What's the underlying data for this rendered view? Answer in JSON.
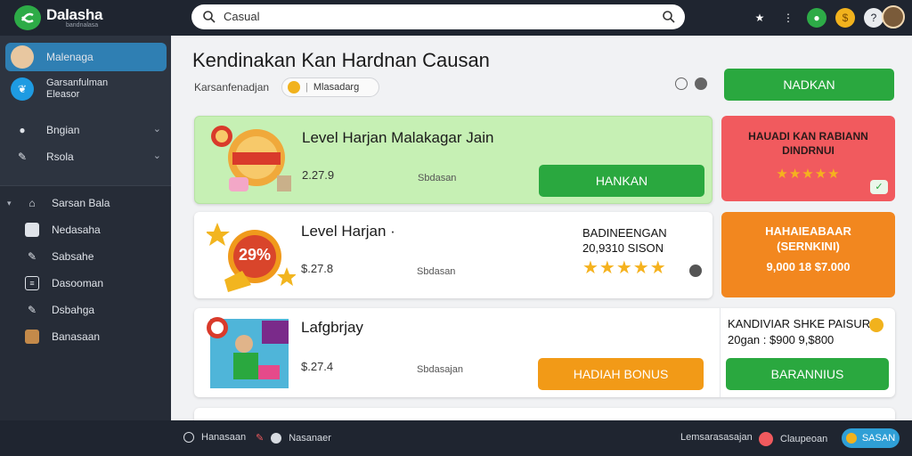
{
  "app": {
    "brand": "Dalasha",
    "brand_sub": "bandnalasa"
  },
  "search": {
    "value": "Casual"
  },
  "sidebar": {
    "items": [
      {
        "label": "Malenaga"
      },
      {
        "label": "Garsanfulman Eleasor"
      },
      {
        "label": "Bngian"
      },
      {
        "label": "Rsola"
      },
      {
        "label": "Sarsan Bala"
      },
      {
        "label": "Nedasaha"
      },
      {
        "label": "Sabsahe"
      },
      {
        "label": "Dasooman"
      },
      {
        "label": "Dsbahga"
      },
      {
        "label": "Banasaan"
      }
    ]
  },
  "main": {
    "title": "Kendinakan Kan Hardnan Causan",
    "breadcrumb": "Karsanfenadjan",
    "chip_label": "Mlasadarg",
    "top_button": "NADKAN"
  },
  "cards": [
    {
      "title": "Level Harjan Malakagar Jain",
      "price": "2.27.9",
      "sub": "Sbdasan",
      "button": "HANKAN"
    },
    {
      "title": "Level Harjan ·",
      "price": "$.27.8",
      "sub": "Sbdasan",
      "promo_title": "BADINEENGAN",
      "promo_line": "20,9310 SISON",
      "art_badge": "29%"
    },
    {
      "title": "Lafgbrjay",
      "price": "$.27.4",
      "sub": "Sbdasajan",
      "button": "HADIAH BONUS"
    }
  ],
  "side_cards": [
    {
      "title": "HAUADI KAN RABIANN",
      "subtitle": "DINDRNUI"
    },
    {
      "title": "HAHAIEABAAR",
      "subtitle": "(SERNKINI)",
      "line": "9,000 18 $7.000"
    },
    {
      "title": "KANDIVIAR SHKE PAISUR",
      "line": "20gan : $900 9,$800",
      "button": "BARANNIUS"
    }
  ],
  "bottombar": {
    "left_1": "Hanasaan",
    "left_2": "Nasanaer",
    "right_1": "Lemsarasasajan",
    "right_2": "Claupeoan",
    "right_3": "SASAN"
  },
  "colors": {
    "green": "#2aa83f",
    "orange": "#f29a17",
    "red": "#f15a5e",
    "dark": "#1f2530",
    "sidebar_active": "#2f7fb3"
  }
}
